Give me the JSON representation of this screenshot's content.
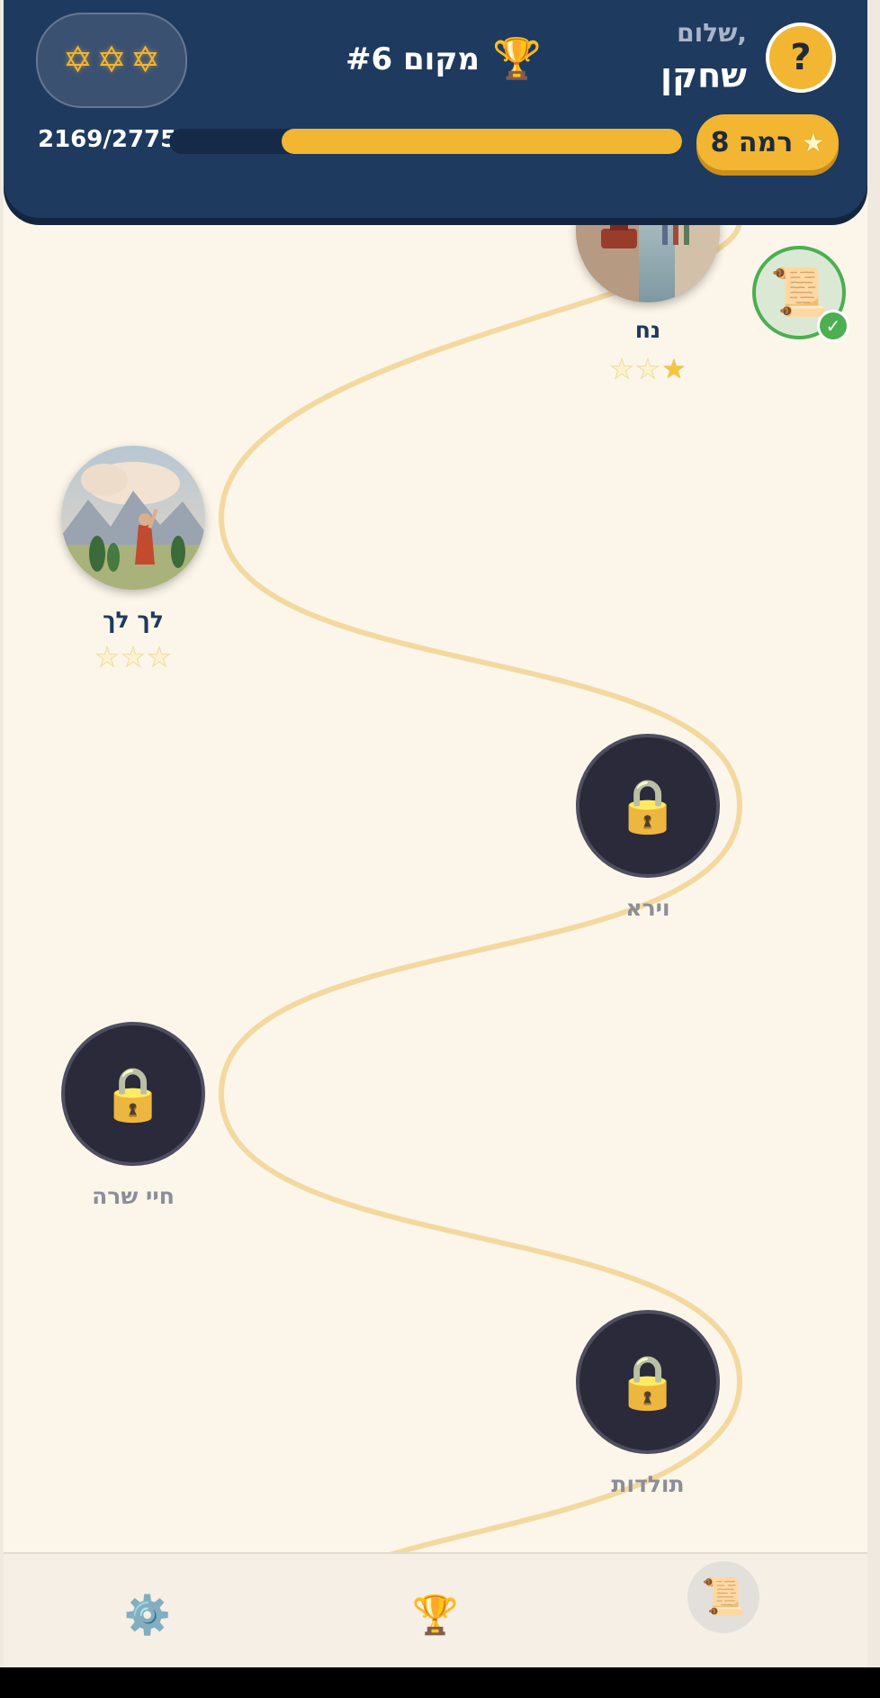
{
  "header": {
    "stars_icon": "star-of-david-icon",
    "stars_count": 3,
    "rank_label": "מקום #6",
    "greeting": "שלום,",
    "player_name": "שחקן",
    "help_label": "?",
    "xp_text": "2169/2775",
    "xp_progress": 0.78,
    "level_label": "רמה 8"
  },
  "map": {
    "nodes": [
      {
        "name": "נח",
        "status": "completed",
        "stars": 1
      },
      {
        "name": "לך לך",
        "status": "unlocked",
        "stars": 0
      },
      {
        "name": "וירא",
        "status": "locked"
      },
      {
        "name": "חיי שרה",
        "status": "locked"
      },
      {
        "name": "תולדות",
        "status": "locked"
      }
    ],
    "side_badge_icon": "scroll-icon"
  },
  "nav": {
    "items": [
      {
        "icon": "gear-icon"
      },
      {
        "icon": "trophy-icon"
      },
      {
        "icon": "scroll-icon",
        "active": true
      }
    ]
  },
  "colors": {
    "header_bg": "#1f3a5f",
    "accent": "#f2b632",
    "path": "#f3d9a0",
    "completed": "#4caf50",
    "locked_node": "#2a2a3a"
  }
}
